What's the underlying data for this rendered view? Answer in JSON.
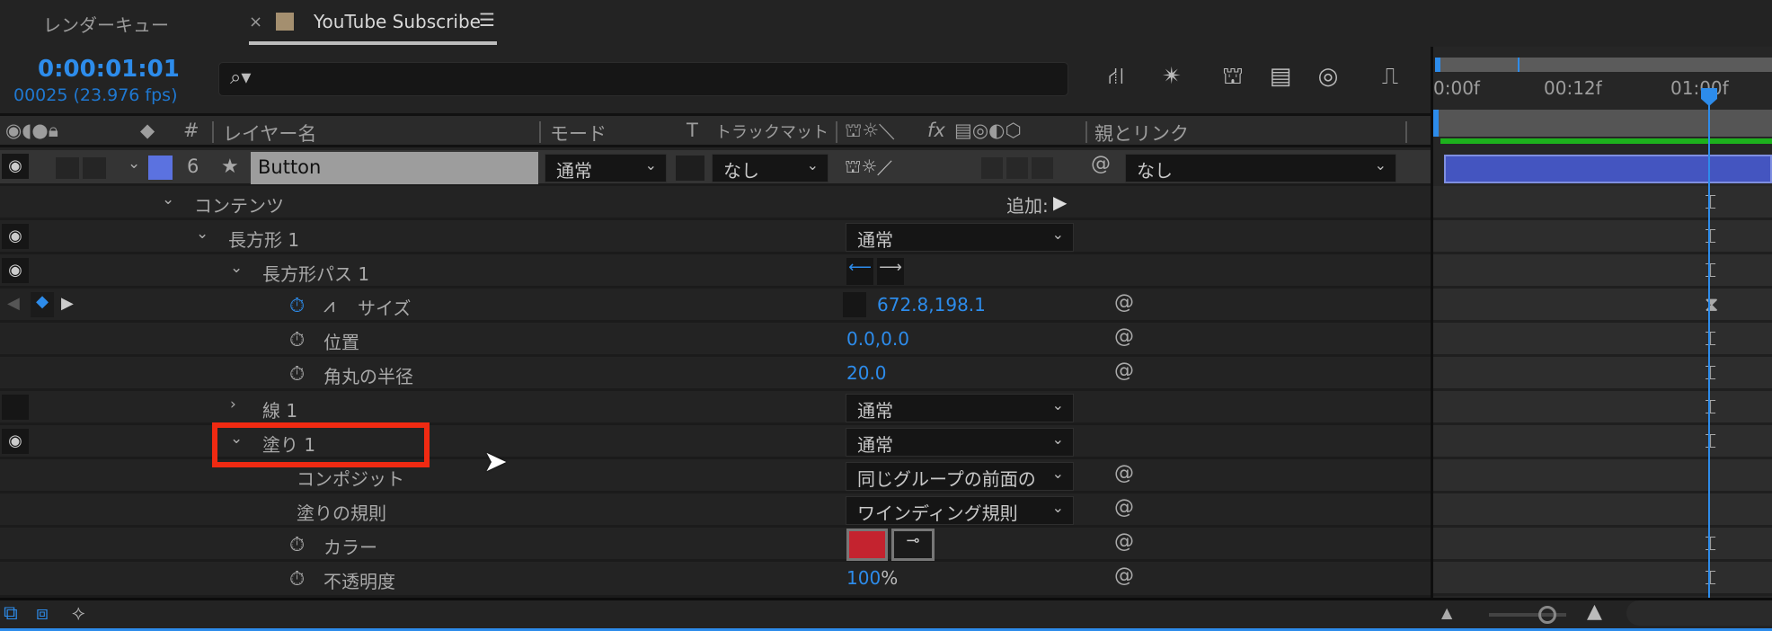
{
  "tabs": {
    "render_queue": "レンダーキュー",
    "comp": "YouTube Subscribe",
    "close": "×",
    "menu": "☰"
  },
  "time": {
    "timecode": "0:00:01:01",
    "frames": "00025 (23.976 fps)"
  },
  "search": {
    "icon": "⌕▾",
    "value": ""
  },
  "toolbar": [
    "composition-flowchart-icon",
    "draft-3d-icon",
    "shy-icon",
    "frame-blending-icon",
    "motion-blur-icon",
    "graph-editor-icon"
  ],
  "columns": {
    "layer_name": "レイヤー名",
    "mode": "モード",
    "t": "T",
    "track_matte": "トラックマット",
    "fx": "fx",
    "parent": "親とリンク",
    "num": "#"
  },
  "layer": {
    "number": "6",
    "name": "Button",
    "mode": "通常",
    "matte": "なし",
    "parent": "なし",
    "label_color": "#5b72e0"
  },
  "rows": {
    "contents": "コンテンツ",
    "add": "追加:",
    "rect": "長方形 1",
    "rect_mode": "通常",
    "rect_path": "長方形パス 1",
    "size": "サイズ",
    "size_val": "672.8,198.1",
    "position": "位置",
    "position_val": "0.0,0.0",
    "roundness": "角丸の半径",
    "roundness_val": "20.0",
    "stroke": "線 1",
    "stroke_mode": "通常",
    "fill": "塗り 1",
    "fill_mode": "通常",
    "composite": "コンポジット",
    "composite_val": "同じグループの前面の",
    "fill_rule": "塗りの規則",
    "fill_rule_val": "ワインディング規則",
    "color": "カラー",
    "color_val": "#c4232f",
    "opacity": "不透明度",
    "opacity_val": "100",
    "opacity_unit": "%"
  },
  "timeline": {
    "ticks": [
      "0:00f",
      "00:12f",
      "01:00f"
    ],
    "accent": "#2d8ceb",
    "bar_color": "#4455c0",
    "work_color": "#1db11d"
  }
}
